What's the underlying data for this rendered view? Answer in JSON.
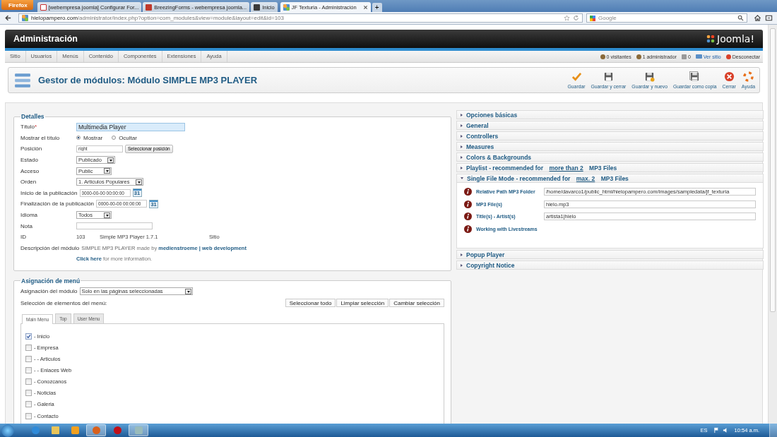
{
  "browser": {
    "menu_button": "Firefox",
    "tabs": [
      {
        "title": "[webempresa joomla] Configurar For...",
        "kind": "mail",
        "selected": false
      },
      {
        "title": "BreezingForms - webempresa joomla...",
        "kind": "w",
        "selected": false
      },
      {
        "title": "Inicio",
        "kind": "site",
        "selected": false
      },
      {
        "title": "JF Texturia - Administración",
        "kind": "joomla",
        "selected": true
      }
    ],
    "new_tab": "+",
    "url_host": "hielopampero.com",
    "url_path": "/administrator/index.php?option=com_modules&view=module&layout=edit&id=103",
    "search_placeholder": "Google"
  },
  "admin": {
    "title": "Administración",
    "logo": "Joomla!",
    "menu": [
      "Sitio",
      "Usuarios",
      "Menús",
      "Contenido",
      "Componentes",
      "Extensiones",
      "Ayuda"
    ],
    "status": [
      {
        "text": "0 visitantes",
        "kind": "users"
      },
      {
        "text": "1 administrador",
        "kind": "admin"
      },
      {
        "text": "0",
        "kind": "mail"
      },
      {
        "text": "Ver sitio",
        "kind": "site"
      },
      {
        "text": "Desconectar",
        "kind": "logout"
      }
    ],
    "page_title": "Gestor de módulos: Módulo SIMPLE MP3 PLAYER",
    "toolbar": [
      {
        "label": "Guardar",
        "kind": "check"
      },
      {
        "label": "Guardar y cerrar",
        "kind": "save"
      },
      {
        "label": "Guardar y nuevo",
        "kind": "save-new"
      },
      {
        "label": "Guardar como copia",
        "kind": "save-copy"
      },
      {
        "label": "Cerrar",
        "kind": "close"
      },
      {
        "label": "Ayuda",
        "kind": "help"
      }
    ]
  },
  "details": {
    "legend": "Detalles",
    "fields": [
      {
        "kind": "title",
        "label": "Título",
        "required": "*",
        "value": "Multimedia Player"
      },
      {
        "kind": "radio",
        "label": "Mostrar el título",
        "options": [
          {
            "label": "Mostrar",
            "selected": true
          },
          {
            "label": "Ocultar",
            "selected": false
          }
        ]
      },
      {
        "kind": "position",
        "label": "Posición",
        "value": "right",
        "button": "Seleccionar posición"
      },
      {
        "kind": "select",
        "label": "Estado",
        "value": "Publicado"
      },
      {
        "kind": "select",
        "label": "Acceso",
        "value": "Public"
      },
      {
        "kind": "select",
        "label": "Orden",
        "value": "1. Articulos Populares"
      },
      {
        "kind": "date",
        "label": "Inicio de la publicación",
        "value": "0000-00-00 00:00:00",
        "icon": "31"
      },
      {
        "kind": "date",
        "label": "Finalización de la publicación",
        "value": "0000-00-00 00:00:00",
        "icon": "31"
      },
      {
        "kind": "select",
        "label": "Idioma",
        "value": "Todos"
      },
      {
        "kind": "text",
        "label": "Nota"
      },
      {
        "kind": "static",
        "label": "ID",
        "values": [
          "103",
          "Simple MP3 Player 1.7.1",
          "Sitio"
        ]
      },
      {
        "kind": "description",
        "label": "Descripción del módulo",
        "name": "SIMPLE MP3 PLAYER",
        "text": "made by",
        "link": "medienstroeme | web development"
      },
      {
        "kind": "more",
        "link": "Click here",
        "text": "for more information."
      }
    ]
  },
  "assignment": {
    "legend": "Asignación de menú",
    "label": "Asignación del módulo",
    "value": "Solo en las páginas seleccionadas",
    "selection_label": "Selección de elementos del menú:",
    "buttons": [
      "Seleccionar todo",
      "Limpiar selección",
      "Cambiar selección"
    ],
    "tabs": [
      {
        "label": "Main Menu",
        "selected": true
      },
      {
        "label": "Top",
        "selected": false
      },
      {
        "label": "User Menu",
        "selected": false
      }
    ],
    "items": [
      {
        "label": "- Inicio",
        "checked": true
      },
      {
        "label": "- Empresa",
        "checked": false
      },
      {
        "label": "- - Articulos",
        "checked": false
      },
      {
        "label": "- - Enlaces Web",
        "checked": false
      },
      {
        "label": "- Conozcanos",
        "checked": false
      },
      {
        "label": "- Noticias",
        "checked": false
      },
      {
        "label": "- Galeria",
        "checked": false
      },
      {
        "label": "- Contacto",
        "checked": false
      }
    ]
  },
  "panels": [
    {
      "title": "Opciones básicas",
      "expanded": false
    },
    {
      "title": "General",
      "expanded": false
    },
    {
      "title": "Controllers",
      "expanded": false
    },
    {
      "title": "Measures",
      "expanded": false
    },
    {
      "title": "Colors & Backgrounds",
      "expanded": false
    },
    {
      "title": "Playlist - recommended for",
      "link": "more than 2",
      "title_end": "MP3 Files",
      "expanded": false
    },
    {
      "title": "Single File Mode - recommended for",
      "link": "max. 2",
      "title_end": "MP3 Files",
      "expanded": true,
      "fields": [
        {
          "label": "Relative Path MP3 Folder",
          "value": "/home/davarco1/public_html/hielopampero.com/images/sampledata/jf_texturia"
        },
        {
          "label": "MP3 File(s)",
          "value": "hielo.mp3"
        },
        {
          "label": "Title(s) - Artist(s)",
          "value": "artista1|hielo"
        },
        {
          "label": "Working with Livestreams"
        }
      ]
    },
    {
      "title": "Popup Player",
      "expanded": false
    },
    {
      "title": "Copyright Notice",
      "expanded": false
    }
  ],
  "taskbar": {
    "apps": [
      {
        "kind": "ie",
        "active": false
      },
      {
        "kind": "folder",
        "active": false
      },
      {
        "kind": "media",
        "active": false
      },
      {
        "kind": "firefox",
        "active": true
      },
      {
        "kind": "opera",
        "active": false
      },
      {
        "kind": "app",
        "active": true
      }
    ],
    "language": "ES",
    "time": "10:54 a.m."
  }
}
